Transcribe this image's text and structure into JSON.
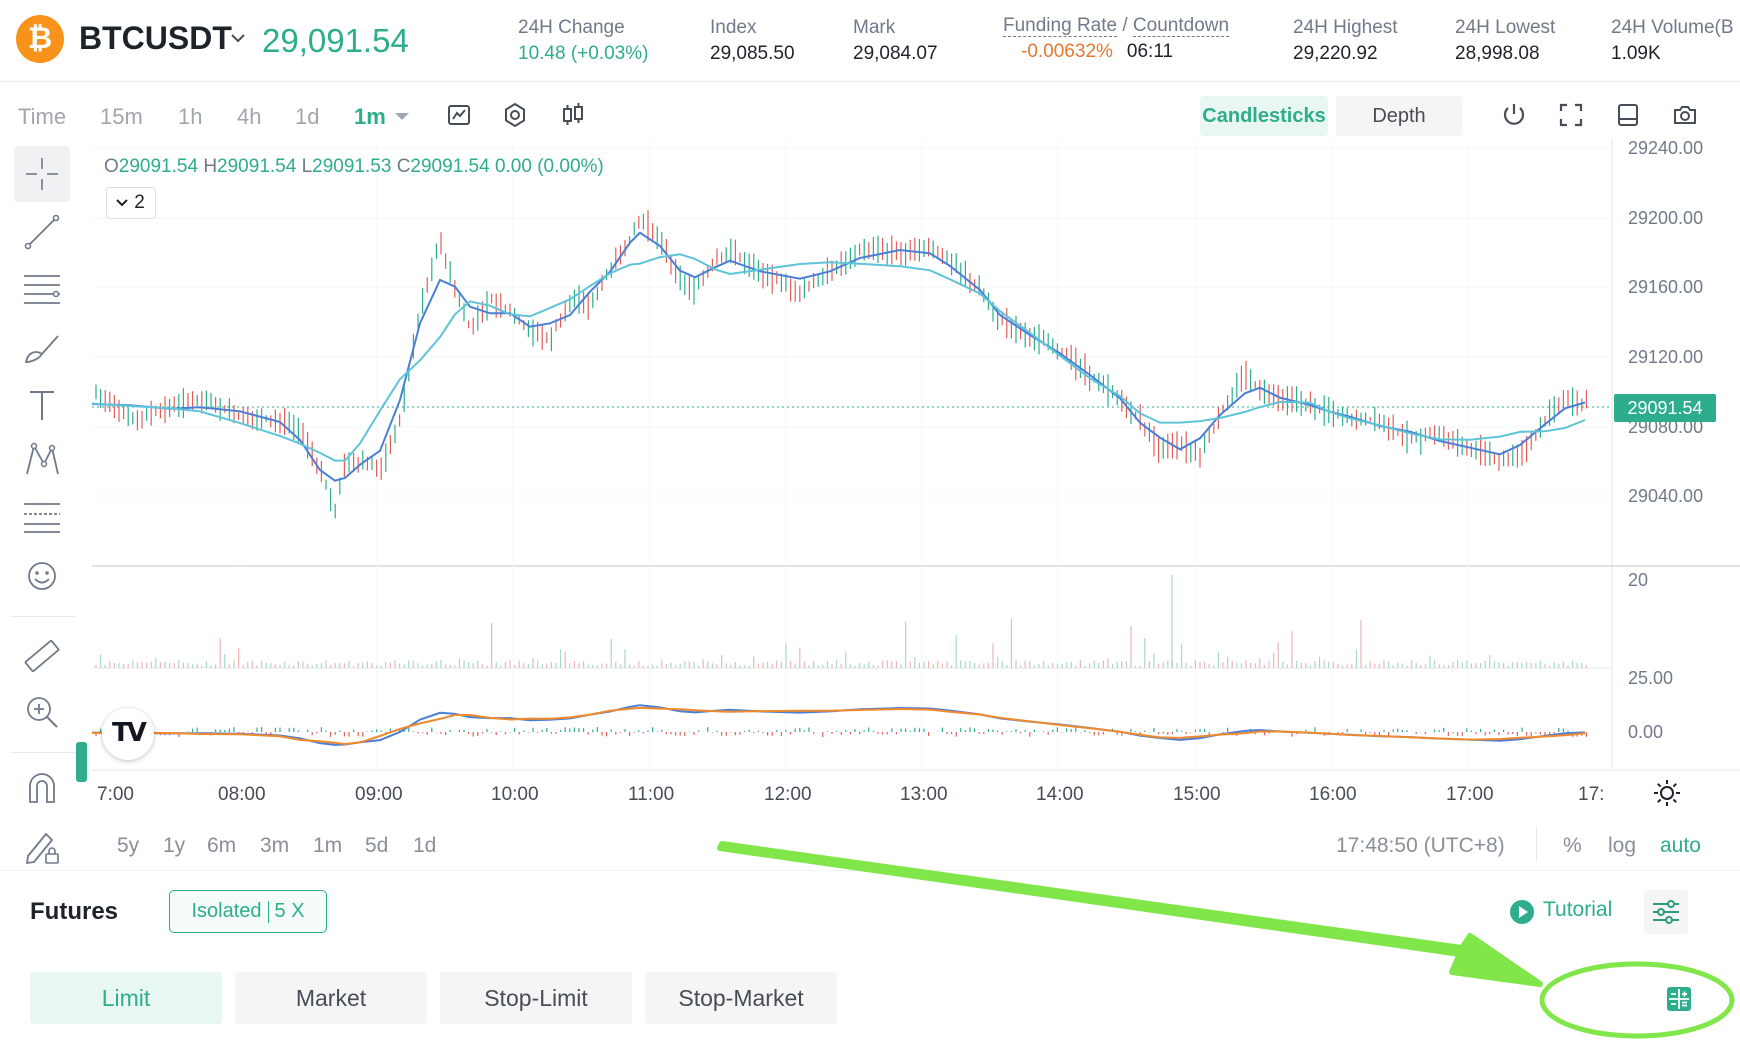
{
  "header": {
    "coin_glyph": "₿",
    "symbol": "BTCUSDT",
    "last_price": "29,091.54",
    "stats": [
      {
        "label": "24H Change",
        "value": "10.48 (+0.03%)"
      },
      {
        "label": "Index",
        "value": "29,085.50"
      },
      {
        "label": "Mark",
        "value": "29,084.07"
      },
      {
        "label_a": "Funding Rate",
        "label_sep": " / ",
        "label_b": "Countdown",
        "value_a": "-0.00632%",
        "value_b": "06:11"
      },
      {
        "label": "24H Highest",
        "value": "29,220.92"
      },
      {
        "label": "24H Lowest",
        "value": "28,998.08"
      },
      {
        "label": "24H Volume(B",
        "value": "1.09K"
      }
    ]
  },
  "toolbar": {
    "timeframes": [
      "Time",
      "15m",
      "1h",
      "4h",
      "1d",
      "1m"
    ],
    "active_timeframe": "1m",
    "view_candlesticks": "Candlesticks",
    "view_depth": "Depth"
  },
  "chart": {
    "ohlc": {
      "o_label": "O",
      "o": "29091.54",
      "h_label": "H",
      "h": "29091.54",
      "l_label": "L",
      "l": "29091.53",
      "c_label": "C",
      "c": "29091.54",
      "change": "0.00 (0.00%)"
    },
    "indicator_count": "2",
    "current_price_tag": "29091.54",
    "price_axis": [
      "29240.00",
      "29200.00",
      "29160.00",
      "29120.00",
      "29080.00",
      "29040.00"
    ],
    "volume_axis": [
      "20"
    ],
    "macd_axis": [
      "25.00",
      "0.00"
    ],
    "time_axis": [
      "7:00",
      "08:00",
      "09:00",
      "10:00",
      "11:00",
      "12:00",
      "13:00",
      "14:00",
      "15:00",
      "16:00",
      "17:00",
      "17:"
    ],
    "colors": {
      "up": "#2ead8c",
      "down": "#e35f59",
      "ma_fast": "#4a7fd6",
      "ma_slow": "#5ec4d8",
      "macd_signal": "#f08a2c"
    }
  },
  "range_bar": {
    "ranges": [
      "5y",
      "1y",
      "6m",
      "3m",
      "1m",
      "5d",
      "1d"
    ],
    "clock": "17:48:50 (UTC+8)",
    "percent": "%",
    "log": "log",
    "auto": "auto"
  },
  "futures": {
    "title": "Futures",
    "margin_mode": "Isolated",
    "leverage": "5 X",
    "tutorial": "Tutorial"
  },
  "order_types": [
    "Limit",
    "Market",
    "Stop-Limit",
    "Stop-Market"
  ],
  "icons": {
    "caret": "chevron-down-icon",
    "indicator": "indicator-icon",
    "settings": "gear-icon",
    "chart_type": "candlestick-icon",
    "power": "power-icon",
    "fullscreen": "fullscreen-icon",
    "layout": "layout-icon",
    "screenshot": "camera-icon",
    "calculator": "calculator-icon"
  },
  "annotation": {
    "arrow_color": "#7ee247"
  }
}
